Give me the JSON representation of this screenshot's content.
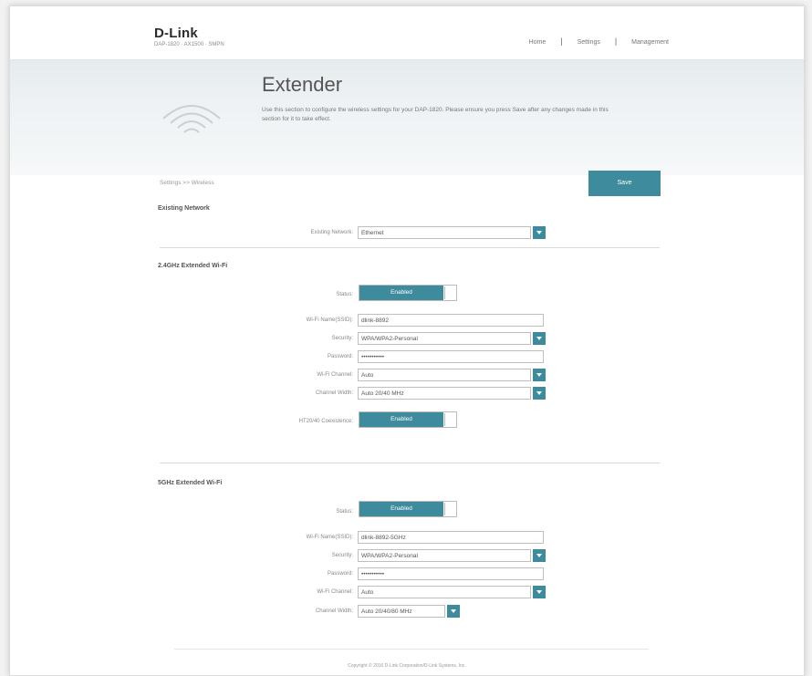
{
  "brand": {
    "logo": "D-Link",
    "model_line": "DAP-1820 · AX1500 · SMPN"
  },
  "nav": {
    "home": "Home",
    "settings": "Settings",
    "management": "Management"
  },
  "banner": {
    "title": "Extender",
    "description": "Use this section to configure the wireless settings for your DAP-1820. Please ensure you press Save after any changes made in this section for it to take effect."
  },
  "breadcrumb": "Settings >> Wireless",
  "save_label": "Save",
  "existing_network": {
    "title": "Existing Network",
    "label": "Existing Network:",
    "value": "Ethernet"
  },
  "band_24": {
    "title": "2.4GHz Extended Wi-Fi",
    "status_label": "Status:",
    "status_value": "Enabled",
    "ssid_label": "Wi-Fi Name(SSID):",
    "ssid_value": "dlink-8892",
    "security_label": "Security:",
    "security_value": "WPA/WPA2-Personal",
    "password_label": "Password:",
    "password_value": "•••••••••••",
    "channel_label": "Wi-Fi Channel:",
    "channel_value": "Auto",
    "width_label": "Channel Width:",
    "width_value": "Auto 20/40 MHz",
    "coexist_label": "HT20/40 Coexistence:",
    "coexist_value": "Enabled"
  },
  "band_5": {
    "title": "5GHz Extended Wi-Fi",
    "status_label": "Status:",
    "status_value": "Enabled",
    "ssid_label": "Wi-Fi Name(SSID):",
    "ssid_value": "dlink-8892-5GHz",
    "security_label": "Security:",
    "security_value": "WPA/WPA2-Personal",
    "password_label": "Password:",
    "password_value": "•••••••••••",
    "channel_label": "Wi-Fi Channel:",
    "channel_value": "Auto",
    "width_label": "Channel Width:",
    "width_value": "Auto 20/40/80 MHz"
  },
  "footer": "Copyright © 2016 D-Link Corporation/D-Link Systems, Inc.",
  "colors": {
    "accent": "#3d8b9c"
  }
}
